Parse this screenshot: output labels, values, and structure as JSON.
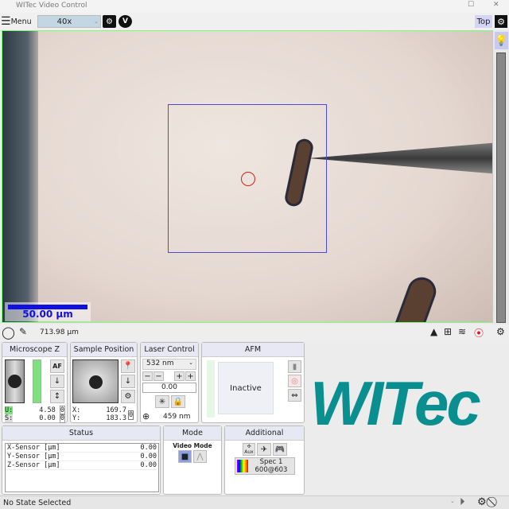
{
  "window": {
    "title": "WITec Video Control"
  },
  "toolbar": {
    "menu_label": "Menu",
    "objective": "40x",
    "top_label": "Top"
  },
  "video": {
    "scale_bar_label": "50.00 µm"
  },
  "bottom_bar": {
    "field_width": "713.98 µm"
  },
  "microscope_z": {
    "title": "Microscope Z",
    "u_label": "U:",
    "u_value": "4.58",
    "s_label": "S:",
    "s_value": "0.00",
    "zero": "0",
    "af": "AF"
  },
  "sample_position": {
    "title": "Sample Position",
    "x_label": "X:",
    "x_value": "169.7",
    "y_label": "Y:",
    "y_value": "183.3",
    "zero": "0"
  },
  "laser_control": {
    "title": "Laser Control",
    "wavelength": "532 nm",
    "power": "0.00",
    "spot": "459 nm",
    "minus": "−",
    "plus": "+"
  },
  "afm": {
    "title": "AFM",
    "state": "Inactive"
  },
  "status": {
    "title": "Status",
    "rows": [
      {
        "name": "X-Sensor [µm]",
        "value": "0.00"
      },
      {
        "name": "Y-Sensor [µm]",
        "value": "0.00"
      },
      {
        "name": "Z-Sensor [µm]",
        "value": "0.00"
      }
    ]
  },
  "mode": {
    "title": "Mode",
    "label": "Video Mode"
  },
  "additional": {
    "title": "Additional",
    "aux": "Aux",
    "spec_line1": "Spec 1",
    "spec_line2": "600@603"
  },
  "logo": {
    "text": "WITec"
  },
  "statusbar": {
    "text": "No State Selected"
  },
  "colors": {
    "accent": "#0a8f90",
    "roi": "#4a4adf",
    "scale": "#1010e0",
    "green": "#7ee07e"
  }
}
